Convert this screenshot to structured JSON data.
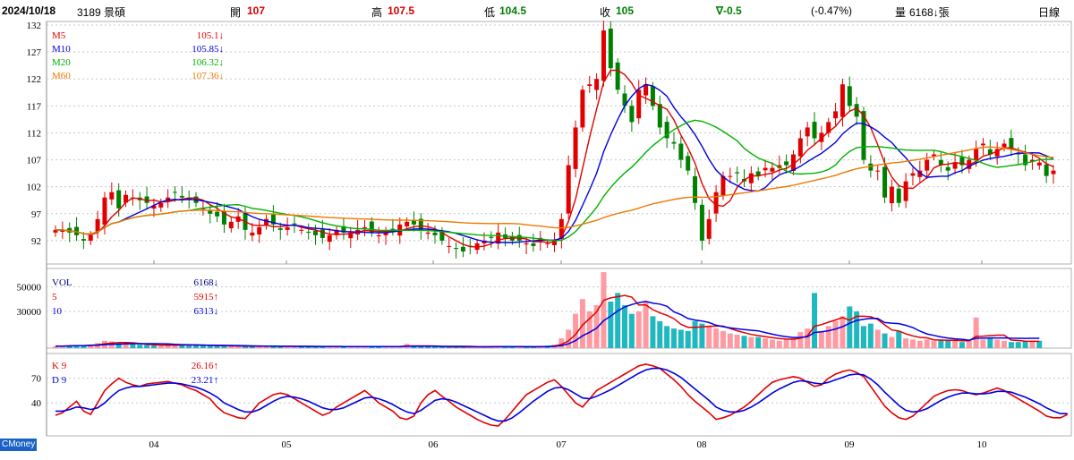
{
  "header": {
    "date": "2024/10/18",
    "stock": "3189 景碩",
    "open_label": "開",
    "open": "107",
    "high_label": "高",
    "high": "107.5",
    "low_label": "低",
    "low": "104.5",
    "close_label": "收",
    "close": "105",
    "change": "∇-0.5",
    "change_pct": "(-0.47%)",
    "volume_label": "量",
    "volume": "6168↓張",
    "period": "日線"
  },
  "brand": "CMoney",
  "chart_data": {
    "type": "candlestick",
    "x_ticks": [
      "04",
      "05",
      "06",
      "07",
      "08",
      "09",
      "10"
    ],
    "price_panel": {
      "y_ticks": [
        132,
        127,
        122,
        117,
        112,
        107,
        102,
        97,
        92
      ],
      "ylim": [
        88,
        132
      ],
      "legend": [
        {
          "name": "M5",
          "value": "105.1↓",
          "color": "#e00000"
        },
        {
          "name": "M10",
          "value": "105.85↓",
          "color": "#0000e0"
        },
        {
          "name": "M20",
          "value": "106.32↓",
          "color": "#00b000"
        },
        {
          "name": "M60",
          "value": "107.36↓",
          "color": "#f07800"
        }
      ],
      "close": [
        94,
        94,
        93.5,
        93,
        92,
        93,
        96,
        100,
        101,
        98,
        100.5,
        100,
        99.5,
        99,
        98.5,
        99,
        100,
        101,
        100,
        99.5,
        99,
        98,
        97,
        96.5,
        95,
        95.5,
        96.5,
        94,
        93.5,
        94.5,
        96,
        95,
        94,
        94.5,
        95,
        94,
        93.5,
        93,
        92.5,
        93,
        94,
        93.5,
        93.5,
        94,
        94.5,
        93.5,
        93,
        93.5,
        94,
        95,
        95.5,
        95,
        94,
        93.5,
        93,
        92,
        91,
        90.5,
        90,
        91,
        91.5,
        92,
        92.5,
        93.5,
        92.5,
        92,
        92,
        91.5,
        91,
        92.5,
        91.5,
        92,
        96,
        106,
        113,
        120,
        121,
        122,
        131,
        124,
        120,
        117,
        114,
        120,
        121,
        117,
        113,
        111,
        110,
        107,
        105,
        99,
        92,
        96,
        101,
        104,
        104,
        104.5,
        103,
        104.5,
        104,
        105.5,
        105.5,
        106,
        106,
        108,
        111,
        113,
        111,
        112,
        114,
        116,
        121,
        117,
        115,
        107,
        105,
        105,
        100,
        102,
        99,
        103,
        104.5,
        105,
        107,
        108,
        106,
        105,
        106.5,
        106,
        107,
        109,
        110,
        108,
        109,
        110,
        109,
        108,
        106,
        107,
        106.5,
        104,
        105
      ],
      "ma5_end": 105.1,
      "ma10_end": 105.85,
      "ma20_end": 106.32,
      "ma60_end": 107.36
    },
    "volume_panel": {
      "y_ticks": [
        50000,
        30000
      ],
      "ylim": [
        0,
        65000
      ],
      "legend": [
        {
          "name": "VOL",
          "value": "6168↓",
          "color": "#000080"
        },
        {
          "name": "5",
          "value": "5915↑",
          "color": "#e00000"
        },
        {
          "name": "10",
          "value": "6313↓",
          "color": "#0000e0"
        }
      ],
      "values": [
        1500,
        1800,
        2200,
        2500,
        2000,
        3000,
        4000,
        6000,
        5500,
        4000,
        3500,
        3000,
        2800,
        2500,
        2200,
        2000,
        2500,
        3000,
        2800,
        2500,
        2200,
        2000,
        2000,
        1800,
        1800,
        1500,
        1600,
        1500,
        1400,
        1500,
        1600,
        1500,
        1400,
        1400,
        1500,
        1400,
        1300,
        1200,
        1200,
        1300,
        1400,
        1300,
        1200,
        1300,
        1400,
        1200,
        1100,
        1200,
        1300,
        1500,
        3500,
        1500,
        1300,
        1200,
        1200,
        1100,
        1000,
        1000,
        1000,
        1100,
        1200,
        1100,
        1300,
        1500,
        1200,
        1100,
        1100,
        1000,
        1000,
        1500,
        2000,
        3000,
        8000,
        15000,
        28000,
        40000,
        30000,
        35000,
        62000,
        38000,
        45000,
        35000,
        28000,
        30000,
        38000,
        26000,
        22000,
        18000,
        16000,
        15000,
        14000,
        22000,
        20000,
        18000,
        16000,
        14000,
        12000,
        11000,
        10000,
        9000,
        9000,
        8000,
        7000,
        6000,
        7000,
        8000,
        13000,
        16000,
        45000,
        14000,
        18000,
        22000,
        26000,
        34000,
        30000,
        18000,
        20000,
        15000,
        12000,
        9000,
        14000,
        8000,
        7000,
        6000,
        7000,
        6000,
        7000,
        6000,
        6000,
        5000,
        6000,
        25000,
        7000,
        8000,
        7000,
        6000,
        5000,
        5000,
        5500,
        6168,
        6000
      ]
    },
    "kd_panel": {
      "y_ticks": [
        70,
        40
      ],
      "ylim": [
        0,
        100
      ],
      "legend": [
        {
          "name": "K 9",
          "value": "26.16↑",
          "color": "#e00000"
        },
        {
          "name": "D 9",
          "value": "23.21↑",
          "color": "#0000e0"
        }
      ],
      "K": [
        25,
        28,
        35,
        42,
        30,
        26,
        40,
        55,
        63,
        70,
        65,
        62,
        60,
        63,
        64,
        65,
        66,
        64,
        62,
        58,
        55,
        50,
        45,
        35,
        28,
        25,
        22,
        21,
        30,
        40,
        45,
        50,
        52,
        50,
        45,
        40,
        35,
        30,
        25,
        28,
        35,
        40,
        45,
        50,
        55,
        48,
        40,
        35,
        30,
        22,
        20,
        24,
        40,
        50,
        55,
        48,
        42,
        35,
        30,
        25,
        20,
        16,
        13,
        12,
        20,
        30,
        40,
        50,
        55,
        60,
        65,
        68,
        60,
        50,
        40,
        35,
        45,
        55,
        60,
        65,
        70,
        75,
        80,
        85,
        87,
        85,
        82,
        75,
        68,
        60,
        50,
        42,
        35,
        28,
        20,
        22,
        25,
        30,
        35,
        42,
        50,
        58,
        65,
        68,
        70,
        72,
        70,
        65,
        60,
        62,
        70,
        75,
        78,
        80,
        77,
        72,
        60,
        48,
        36,
        28,
        22,
        20,
        24,
        32,
        40,
        48,
        52,
        55,
        56,
        55,
        52,
        50,
        52,
        55,
        58,
        55,
        50,
        45,
        40,
        35,
        30,
        24,
        22,
        22,
        26
      ],
      "D": [
        30,
        30,
        32,
        35,
        34,
        32,
        34,
        40,
        48,
        55,
        58,
        60,
        60,
        61,
        62,
        63,
        64,
        64,
        63,
        61,
        59,
        56,
        52,
        47,
        40,
        36,
        32,
        29,
        29,
        32,
        37,
        42,
        46,
        48,
        47,
        45,
        42,
        38,
        34,
        32,
        32,
        34,
        38,
        42,
        46,
        47,
        45,
        42,
        38,
        33,
        29,
        27,
        31,
        37,
        43,
        45,
        44,
        41,
        37,
        33,
        29,
        25,
        21,
        18,
        18,
        22,
        28,
        35,
        42,
        48,
        54,
        58,
        59,
        56,
        51,
        46,
        45,
        48,
        52,
        56,
        61,
        66,
        71,
        76,
        80,
        82,
        82,
        80,
        76,
        71,
        64,
        57,
        50,
        43,
        35,
        31,
        29,
        29,
        31,
        35,
        40,
        46,
        52,
        57,
        61,
        65,
        67,
        66,
        64,
        63,
        65,
        68,
        71,
        74,
        75,
        74,
        69,
        62,
        53,
        45,
        37,
        31,
        29,
        30,
        33,
        38,
        43,
        47,
        50,
        52,
        52,
        51,
        51,
        52,
        54,
        54,
        53,
        50,
        47,
        43,
        39,
        34,
        30,
        27,
        27
      ]
    }
  }
}
